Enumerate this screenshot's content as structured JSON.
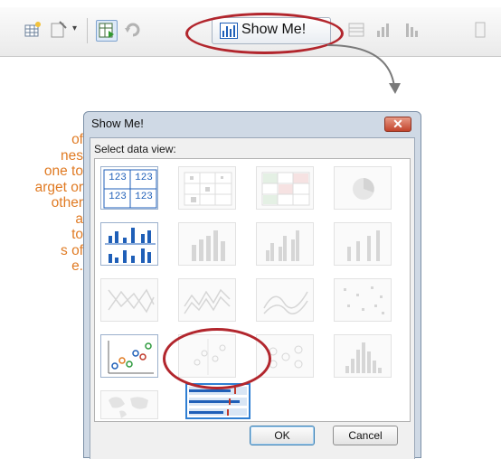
{
  "toolbar": {
    "showme_label": "Show Me!",
    "icons": [
      "new-worksheet-icon",
      "clear-sheet-icon",
      "dropdown-arrow-icon",
      "swap-axes-icon",
      "refresh-icon",
      "bar-chart-icon",
      "group-icon",
      "sort-ascending-icon",
      "sort-descending-icon",
      "more-icon"
    ]
  },
  "side_text": {
    "lines": [
      "of",
      "nes",
      "one to",
      "arget or",
      "other",
      "a",
      "to",
      "s of",
      "e."
    ]
  },
  "dialog": {
    "title": "Show Me!",
    "close_glyph": "✕",
    "prompt": "Select data view:",
    "text_table_digits": "123",
    "ok_label": "OK",
    "cancel_label": "Cancel",
    "chart_types": [
      {
        "name": "text-table",
        "state": "available"
      },
      {
        "name": "heat-map",
        "state": "unavailable"
      },
      {
        "name": "highlight-table",
        "state": "unavailable"
      },
      {
        "name": "pie-chart",
        "state": "unavailable"
      },
      {
        "name": "horizontal-bars",
        "state": "available"
      },
      {
        "name": "stacked-bars",
        "state": "unavailable"
      },
      {
        "name": "side-by-side-bars",
        "state": "unavailable"
      },
      {
        "name": "gantt-bars",
        "state": "unavailable"
      },
      {
        "name": "lines-discrete",
        "state": "unavailable"
      },
      {
        "name": "lines-continuous",
        "state": "unavailable"
      },
      {
        "name": "dual-lines",
        "state": "unavailable"
      },
      {
        "name": "circle-views",
        "state": "unavailable"
      },
      {
        "name": "scatter-plot",
        "state": "available"
      },
      {
        "name": "scatter-matrix",
        "state": "unavailable"
      },
      {
        "name": "side-by-side-circles",
        "state": "unavailable"
      },
      {
        "name": "histogram",
        "state": "unavailable"
      },
      {
        "name": "map",
        "state": "unavailable"
      },
      {
        "name": "bullet-graph",
        "state": "selected"
      }
    ]
  },
  "colors": {
    "annotation_red": "#b2262d",
    "side_text_orange": "#e07b24",
    "selection_blue": "#2f7fd3",
    "chart_blue": "#1f5fb8"
  }
}
